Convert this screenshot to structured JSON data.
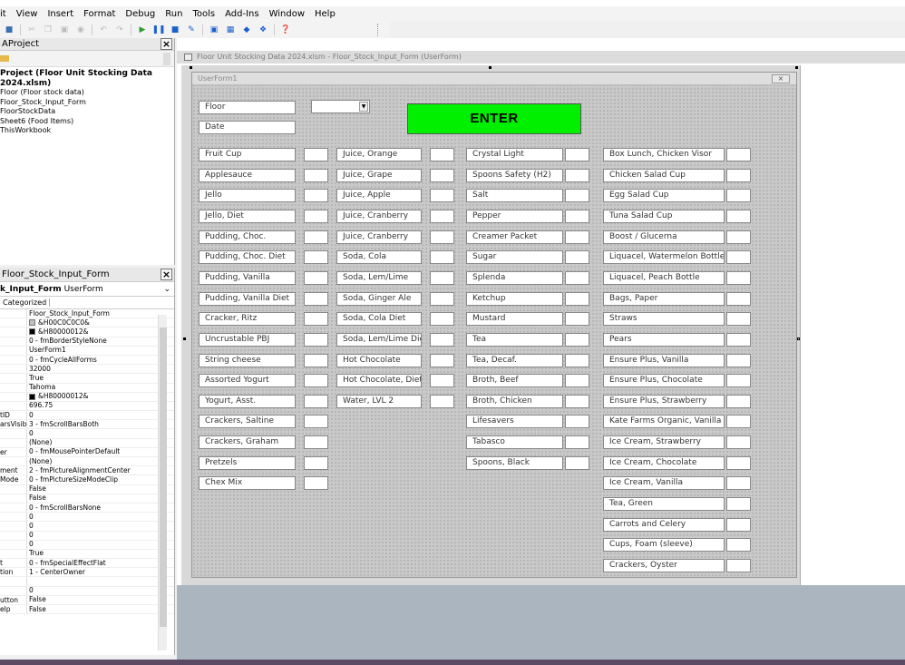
{
  "menu": [
    "it",
    "View",
    "Insert",
    "Format",
    "Debug",
    "Run",
    "Tools",
    "Add-Ins",
    "Window",
    "Help"
  ],
  "project": {
    "title": "AProject",
    "root": "Project (Floor Unit Stocking Data 2024.xlsm)",
    "items": [
      "Floor (Floor stock data)",
      "Floor_Stock_Input_Form",
      "FloorStockData",
      "Sheet6 (Food Items)",
      "ThisWorkbook"
    ]
  },
  "properties": {
    "title": "Floor_Stock_Input_Form",
    "object_bold": "k_Input_Form",
    "object_type": "UserForm",
    "tab": "Categorized",
    "rows": [
      {
        "n": "",
        "v": "Floor_Stock_Input_Form",
        "c": ""
      },
      {
        "n": "",
        "v": "&H00C0C0C0&",
        "c": "#c0c0c0"
      },
      {
        "n": "",
        "v": "&H80000012&",
        "c": "#000000"
      },
      {
        "n": "",
        "v": "0 - fmBorderStyleNone",
        "c": ""
      },
      {
        "n": "",
        "v": "UserForm1",
        "c": ""
      },
      {
        "n": "",
        "v": "0 - fmCycleAllForms",
        "c": ""
      },
      {
        "n": "",
        "v": "32000",
        "c": ""
      },
      {
        "n": "",
        "v": "True",
        "c": ""
      },
      {
        "n": "",
        "v": "Tahoma",
        "c": ""
      },
      {
        "n": "",
        "v": "&H80000012&",
        "c": "#000000"
      },
      {
        "n": "",
        "v": "696.75",
        "c": ""
      },
      {
        "n": "tID",
        "v": "0",
        "c": ""
      },
      {
        "n": "arsVisible",
        "v": "3 - fmScrollBarsBoth",
        "c": ""
      },
      {
        "n": "",
        "v": "0",
        "c": ""
      },
      {
        "n": "",
        "v": "(None)",
        "c": ""
      },
      {
        "n": "er",
        "v": "0 - fmMousePointerDefault",
        "c": ""
      },
      {
        "n": "",
        "v": "(None)",
        "c": ""
      },
      {
        "n": "ment",
        "v": "2 - fmPictureAlignmentCenter",
        "c": ""
      },
      {
        "n": "Mode",
        "v": "0 - fmPictureSizeModeClip",
        "c": ""
      },
      {
        "n": "",
        "v": "False",
        "c": ""
      },
      {
        "n": "",
        "v": "False",
        "c": ""
      },
      {
        "n": "",
        "v": "0 - fmScrollBarsNone",
        "c": ""
      },
      {
        "n": "",
        "v": "0",
        "c": ""
      },
      {
        "n": "",
        "v": "0",
        "c": ""
      },
      {
        "n": "",
        "v": "0",
        "c": ""
      },
      {
        "n": "",
        "v": "0",
        "c": ""
      },
      {
        "n": "",
        "v": "True",
        "c": ""
      },
      {
        "n": "t",
        "v": "0 - fmSpecialEffectFlat",
        "c": ""
      },
      {
        "n": "tion",
        "v": "1 - CenterOwner",
        "c": ""
      },
      {
        "n": "",
        "v": "",
        "c": ""
      },
      {
        "n": "",
        "v": "0",
        "c": ""
      },
      {
        "n": "utton",
        "v": "False",
        "c": ""
      },
      {
        "n": "elp",
        "v": "False",
        "c": ""
      }
    ]
  },
  "window_title": "Floor Unit Stocking Data 2024.xlsm - Floor_Stock_Input_Form (UserForm)",
  "userform": {
    "caption": "UserForm1",
    "floor_label": "Floor",
    "date_label": "Date",
    "enter_label": "ENTER",
    "columns": [
      [
        "Fruit Cup",
        "Applesauce",
        "Jello",
        "Jello, Diet",
        "Pudding, Choc.",
        "Pudding, Choc. Diet",
        "Pudding, Vanilla",
        "Pudding, Vanilla Diet",
        "Cracker, Ritz",
        "Uncrustable PBJ",
        "String cheese",
        "Assorted Yogurt",
        "Yogurt, Asst.",
        "Crackers, Saltine",
        "Crackers, Graham",
        "Pretzels",
        "Chex Mix"
      ],
      [
        "Juice, Orange",
        "Juice, Grape",
        "Juice, Apple",
        "Juice, Cranberry",
        "Juice, Cranberry",
        "Soda, Cola",
        "Soda, Lem/Lime",
        "Soda, Ginger Ale",
        "Soda, Cola Diet",
        "Soda, Lem/Lime Diet",
        "Hot Chocolate",
        "Hot Chocolate, Diet",
        "Water, LVL 2"
      ],
      [
        "Crystal Light",
        "Spoons Safety (H2)",
        "Salt",
        "Pepper",
        "Creamer Packet",
        "Sugar",
        "Splenda",
        "Ketchup",
        "Mustard",
        "Tea",
        "Tea, Decaf.",
        "Broth, Beef",
        "Broth, Chicken",
        "Lifesavers",
        "Tabasco",
        "Spoons, Black"
      ],
      [
        "Box Lunch, Chicken Visor",
        "Chicken Salad Cup",
        "Egg Salad Cup",
        "Tuna Salad Cup",
        "Boost / Glucerna",
        "Liquacel, Watermelon Bottle",
        "Liquacel, Peach Bottle",
        "Bags, Paper",
        "Straws",
        "Pears",
        "Ensure Plus, Vanilla",
        "Ensure Plus, Chocolate",
        "Ensure Plus, Strawberry",
        "Kate Farms Organic, Vanilla",
        "Ice Cream, Strawberry",
        "Ice Cream, Chocolate",
        "Ice Cream, Vanilla",
        "Tea, Green",
        "Carrots and Celery",
        "Cups, Foam (sleeve)",
        "Crackers, Oyster"
      ]
    ]
  },
  "colors": {
    "enter_button": "#00f000",
    "form_bg": "#c9c9c9"
  }
}
